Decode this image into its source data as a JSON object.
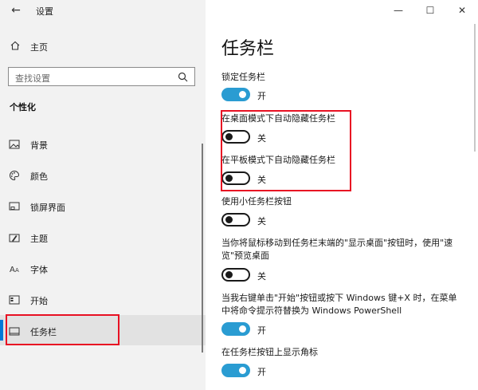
{
  "window": {
    "title": "设置",
    "controls": {
      "minimize": "—",
      "maximize": "☐",
      "close": "✕"
    }
  },
  "sidebar": {
    "back_glyph": "←",
    "home_label": "主页",
    "search_placeholder": "查找设置",
    "section_title": "个性化",
    "items": [
      {
        "label": "背景",
        "icon": "picture-icon"
      },
      {
        "label": "颜色",
        "icon": "palette-icon"
      },
      {
        "label": "锁屏界面",
        "icon": "lockscreen-icon"
      },
      {
        "label": "主题",
        "icon": "theme-brush-icon"
      },
      {
        "label": "字体",
        "icon": "font-icon"
      },
      {
        "label": "开始",
        "icon": "start-icon"
      },
      {
        "label": "任务栏",
        "icon": "taskbar-icon",
        "selected": true
      }
    ]
  },
  "main": {
    "title": "任务栏",
    "settings": [
      {
        "label": "锁定任务栏",
        "state": "开",
        "on": true
      },
      {
        "label": "在桌面模式下自动隐藏任务栏",
        "state": "关",
        "on": false
      },
      {
        "label": "在平板模式下自动隐藏任务栏",
        "state": "关",
        "on": false
      },
      {
        "label": "使用小任务栏按钮",
        "state": "关",
        "on": false
      },
      {
        "label_line1": "当你将鼠标移动到任务栏末端的\"显示桌面\"按钮时，使用\"速",
        "label_line2": "览\"预览桌面",
        "state": "关",
        "on": false
      },
      {
        "label_line1": "当我右键单击\"开始\"按钮或按下 Windows 键+X 时，在菜单",
        "label_line2": "中将命令提示符替换为 Windows PowerShell",
        "state": "开",
        "on": true
      },
      {
        "label": "在任务栏按钮上显示角标",
        "state": "开",
        "on": true
      }
    ]
  },
  "colors": {
    "accent": "#2a9cd2",
    "highlight_box": "#e81123"
  }
}
